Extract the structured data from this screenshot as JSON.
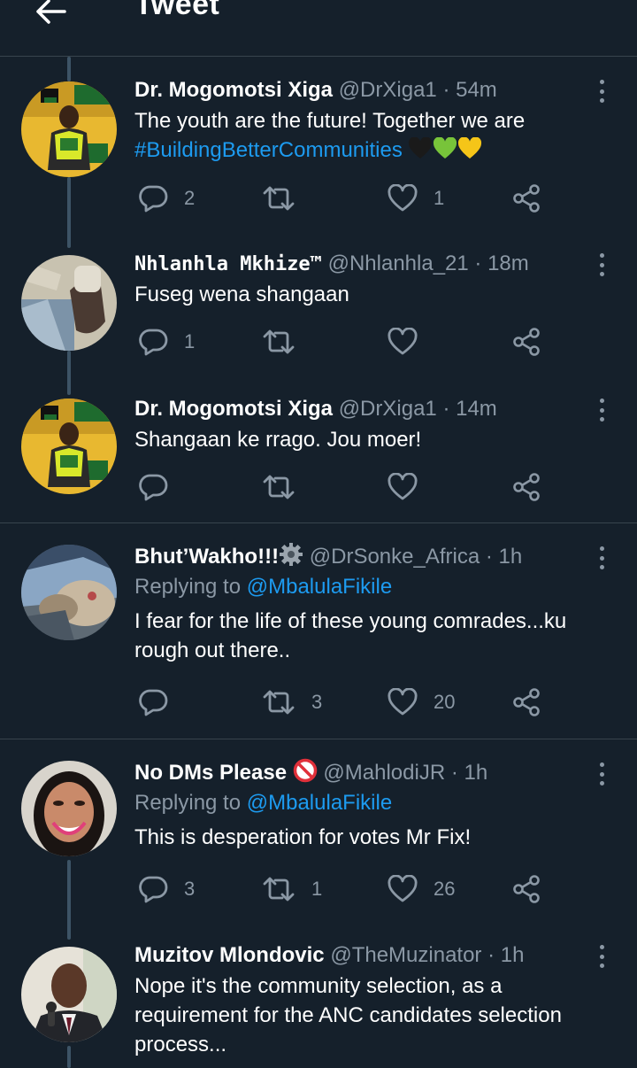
{
  "header": {
    "title": "Tweet"
  },
  "tweets": [
    {
      "name": "Dr. Mogomotsi Xiga",
      "handle": "@DrXiga1",
      "dot": "·",
      "time": "54m",
      "text_main": "The youth are the future! Together we are",
      "hashtag": "#BuildingBetterCommunities",
      "emojis": [
        "black-heart-icon",
        "green-heart-icon",
        "yellow-heart-icon"
      ],
      "replies": "2",
      "retweets": "",
      "likes": "1"
    },
    {
      "name": "Nhlanhla Mkhize™",
      "handle": "@Nhlanhla_21",
      "dot": "·",
      "time": "18m",
      "text": "Fuseg wena shangaan",
      "replies": "1",
      "retweets": "",
      "likes": ""
    },
    {
      "name": "Dr. Mogomotsi Xiga",
      "handle": "@DrXiga1",
      "dot": "·",
      "time": "14m",
      "text": "Shangaan ke rrago. Jou moer!",
      "replies": "",
      "retweets": "",
      "likes": ""
    },
    {
      "name": "Bhut’Wakho!!!",
      "name_icon": "gear-icon",
      "handle": "@DrSonke_Africa",
      "dot": "·",
      "time": "1h",
      "replying_prefix": "Replying to",
      "replying_to": "@MbalulaFikile",
      "text": "I fear for the life of these young comrades...ku rough out there..",
      "replies": "",
      "retweets": "3",
      "likes": "20"
    },
    {
      "name": "No DMs Please",
      "name_icon": "no-entry-icon",
      "handle": "@MahlodiJR",
      "dot": "·",
      "time": "1h",
      "replying_prefix": "Replying to",
      "replying_to": "@MbalulaFikile",
      "text": "This is desperation for votes Mr Fix!",
      "replies": "3",
      "retweets": "1",
      "likes": "26"
    },
    {
      "name": "Muzitov Mlondovic",
      "handle": "@TheMuzinator",
      "dot": "·",
      "time": "1h",
      "text": "Nope it's the community selection, as a requirement for the ANC candidates selection process..."
    }
  ],
  "colors": {
    "background": "#15202b",
    "divider": "#38444d",
    "secondary_text": "#8b98a5",
    "link": "#1d9bf0",
    "thread_line": "#3d5466"
  }
}
